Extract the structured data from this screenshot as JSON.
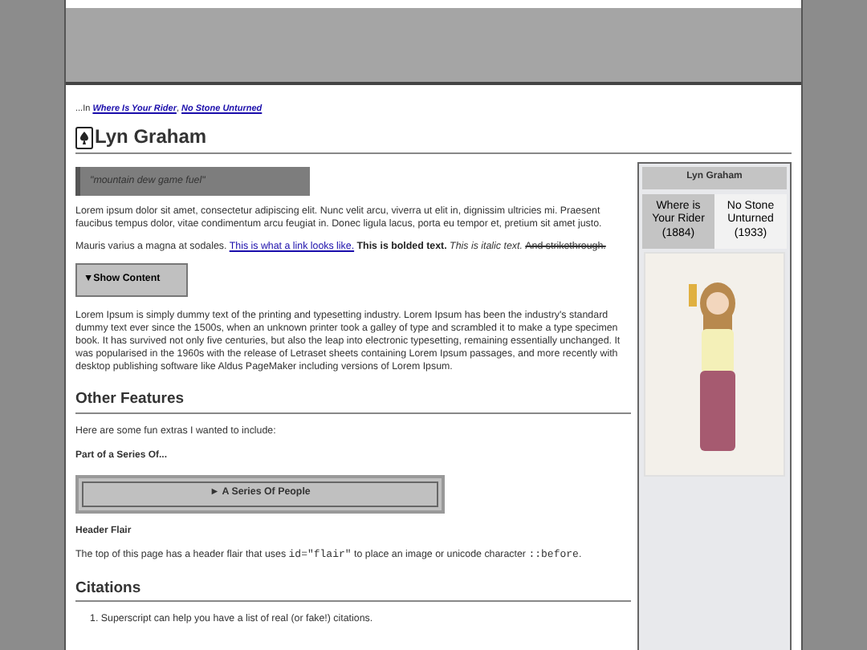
{
  "breadcrumb": {
    "prefix": "...In",
    "links": [
      "Where Is Your Rider",
      "No Stone Unturned"
    ],
    "separator": ","
  },
  "title": "Lyn Graham",
  "quote": "\"mountain dew game fuel\"",
  "paragraphs": [
    {
      "segments": [
        {
          "kind": "text",
          "text": "Lorem ipsum dolor sit amet, consectetur adipiscing elit. Nunc velit arcu, viverra ut elit in, dignissim ultricies mi. Praesent faucibus tempus dolor, vitae condimentum arcu feugiat in. Donec ligula lacus, porta eu tempor et, pretium sit amet justo."
        }
      ]
    },
    {
      "segments": [
        {
          "kind": "text",
          "text": "Mauris varius a magna at sodales. "
        },
        {
          "kind": "link",
          "text": "This is what a link looks like."
        },
        {
          "kind": "bold",
          "text": " This is bolded text."
        },
        {
          "kind": "italic",
          "text": " This is italic text. "
        },
        {
          "kind": "strike",
          "text": "And strikethrough."
        }
      ]
    }
  ],
  "toggle": {
    "arrow": "▼",
    "label": "Show Content",
    "expanded": true
  },
  "lorem": "Lorem Ipsum is simply dummy text of the printing and typesetting industry. Lorem Ipsum has been the industry's standard dummy text ever since the 1500s, when an unknown printer took a galley of type and scrambled it to make a type specimen book. It has survived not only five centuries, but also the leap into electronic typesetting, remaining essentially unchanged. It was popularised in the 1960s with the release of Letraset sheets containing Lorem Ipsum passages, and more recently with desktop publishing software like Aldus PageMaker including versions of Lorem Ipsum.",
  "other_features": {
    "heading": "Other Features",
    "intro": "Here are some fun extras I wanted to include:",
    "series_heading": "Part of a Series Of...",
    "series_box": {
      "arrow": "►",
      "label": "A Series Of People"
    },
    "flair_heading": "Header Flair",
    "flair_text": [
      {
        "kind": "text",
        "text": "The top of this page has a header flair that uses "
      },
      {
        "kind": "code",
        "text": "id=\"flair\""
      },
      {
        "kind": "text",
        "text": " to place an image or unicode character "
      },
      {
        "kind": "code",
        "text": "::before"
      },
      {
        "kind": "text",
        "text": "."
      }
    ]
  },
  "citations": {
    "heading": "Citations",
    "items": [
      {
        "marker": "1.",
        "text": "Superscript can help you have a list of real (or fake!) citations."
      }
    ]
  },
  "infobox": {
    "title": "Lyn Graham",
    "tabs": [
      {
        "label": "Where is Your Rider (1884)",
        "selected": true
      },
      {
        "label": "No Stone Unturned (1933)",
        "selected": false
      }
    ]
  }
}
